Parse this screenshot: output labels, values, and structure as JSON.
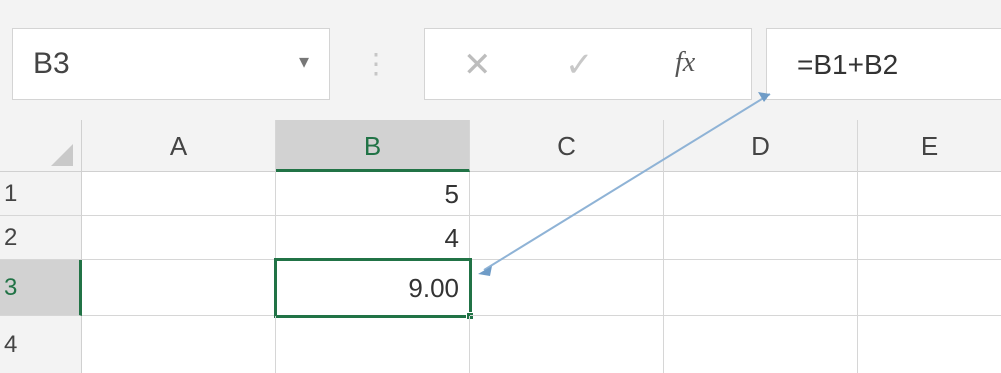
{
  "formula_bar": {
    "name_box": "B3",
    "name_box_arrow": "▾",
    "separator": "⋮",
    "cancel_symbol": "✕",
    "enter_symbol": "✓",
    "fx_symbol": "fx",
    "formula": "=B1+B2"
  },
  "columns": [
    "A",
    "B",
    "C",
    "D",
    "E"
  ],
  "rows": [
    "1",
    "2",
    "3",
    "4"
  ],
  "cells": {
    "B1": "5",
    "B2": "4",
    "B3": "9.00"
  },
  "selected_cell": "B3",
  "colors": {
    "accent": "#217346",
    "arrow": "#8fb3d6"
  }
}
